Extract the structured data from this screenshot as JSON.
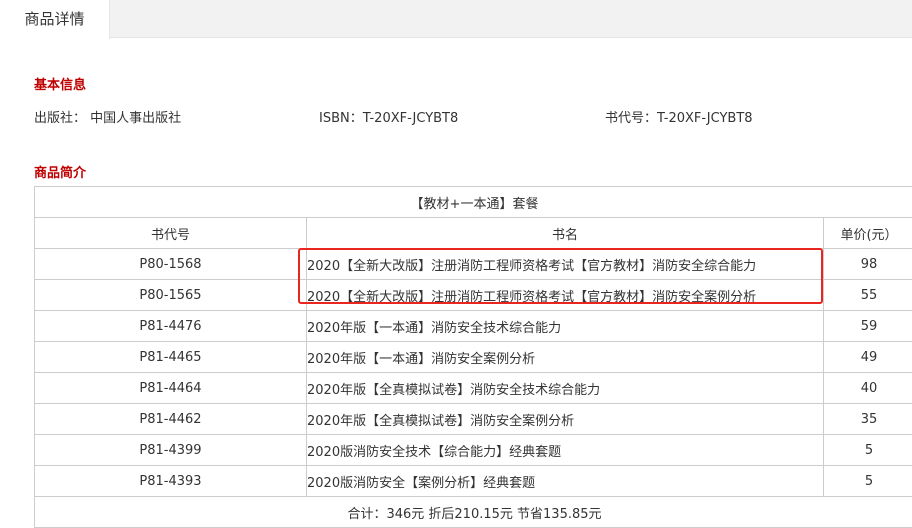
{
  "tabs": {
    "active_label": "商品详情"
  },
  "basic_info": {
    "title": "基本信息",
    "publisher": "出版社： 中国人事出版社",
    "isbn": "ISBN：T-20XF-JCYBT8",
    "book_code": "书代号：T-20XF-JCYBT8"
  },
  "intro": {
    "title": "商品简介",
    "package_caption": "【教材+一本通】套餐",
    "headers": {
      "code": "书代号",
      "name": "书名",
      "price": "单价(元）"
    },
    "rows": [
      {
        "code": "P80-1568",
        "name": "2020【全新大改版】注册消防工程师资格考试【官方教材】消防安全综合能力",
        "price": "98"
      },
      {
        "code": "P80-1565",
        "name": "2020【全新大改版】注册消防工程师资格考试【官方教材】消防安全案例分析",
        "price": "55"
      },
      {
        "code": "P81-4476",
        "name": "2020年版【一本通】消防安全技术综合能力",
        "price": "59"
      },
      {
        "code": "P81-4465",
        "name": "2020年版【一本通】消防安全案例分析",
        "price": "49"
      },
      {
        "code": "P81-4464",
        "name": "2020年版【全真模拟试卷】消防安全技术综合能力",
        "price": "40"
      },
      {
        "code": "P81-4462",
        "name": "2020年版【全真模拟试卷】消防安全案例分析",
        "price": "35"
      },
      {
        "code": "P81-4399",
        "name": "2020版消防安全技术【综合能力】经典套题",
        "price": "5"
      },
      {
        "code": "P81-4393",
        "name": "2020版消防安全【案例分析】经典套题",
        "price": "5"
      }
    ],
    "total": "合计：346元  折后210.15元 节省135.85元"
  },
  "colors": {
    "section_title": "#c00000",
    "highlight_border": "#e8251f",
    "table_border": "#cccccc"
  }
}
